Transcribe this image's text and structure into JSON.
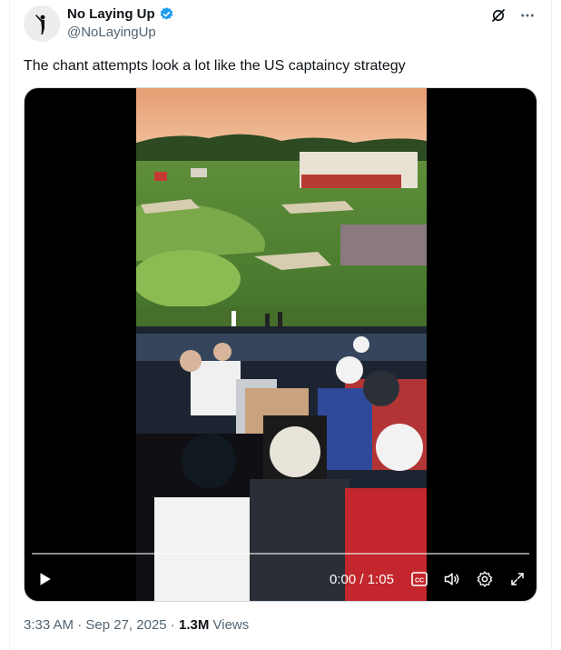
{
  "author": {
    "name": "No Laying Up",
    "handle": "@NoLayingUp",
    "verified_color": "#1d9bf0"
  },
  "tweet": {
    "text": "The chant attempts look a lot like the US captaincy strategy"
  },
  "video": {
    "time_current": "0:00",
    "time_separator": "/",
    "time_total": "1:05",
    "cc_label": "CC"
  },
  "meta": {
    "timestamp": "3:33 AM",
    "dot": "·",
    "date": "Sep 27, 2025",
    "views_count": "1.3M",
    "views_label": "Views"
  },
  "icons": {
    "grok": "grok-icon",
    "more": "more-icon",
    "play": "play-icon",
    "captions": "captions-icon",
    "volume": "volume-icon",
    "settings": "settings-icon",
    "fullscreen": "fullscreen-icon"
  }
}
